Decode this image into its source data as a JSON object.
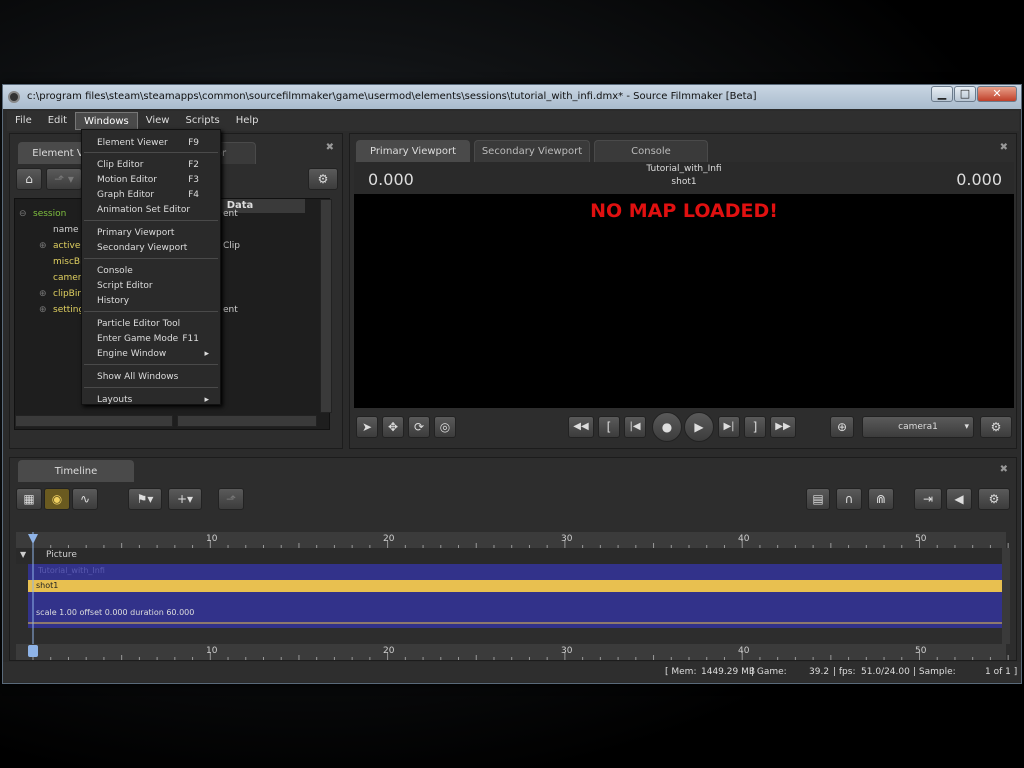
{
  "window": {
    "title": "c:\\program files\\steam\\steamapps\\common\\sourcefilmmaker\\game\\usermod\\elements\\sessions\\tutorial_with_infi.dmx* - Source Filmmaker [Beta]"
  },
  "window_buttons": {
    "minimize": "▁",
    "maximize": "□",
    "close": "✕"
  },
  "menu": [
    "File",
    "Edit",
    "Windows",
    "View",
    "Scripts",
    "Help"
  ],
  "left_panel": {
    "tab1": "Element V",
    "tab2": "or",
    "data_header": "Data",
    "tree": [
      {
        "label": "session",
        "expander": "⊖",
        "color": "#7fbf3f"
      },
      {
        "label": "name",
        "expander": "",
        "color": "#cfcfcf"
      },
      {
        "label": "activeC",
        "expander": "⊕",
        "color": "#e0d060"
      },
      {
        "label": "miscBir",
        "expander": "",
        "color": "#e0d060"
      },
      {
        "label": "camera",
        "expander": "",
        "color": "#e0d060"
      },
      {
        "label": "clipBin",
        "expander": "⊕",
        "color": "#e0d060"
      },
      {
        "label": "setting",
        "expander": "⊕",
        "color": "#e0d060"
      }
    ],
    "data_col": [
      "ent",
      "",
      "Clip",
      "",
      "",
      "",
      "ent"
    ]
  },
  "windows_menu": {
    "items": [
      {
        "label": "Element Viewer",
        "shortcut": "F9"
      },
      {
        "label": "Clip Editor",
        "shortcut": "F2"
      },
      {
        "label": "Motion Editor",
        "shortcut": "F3"
      },
      {
        "label": "Graph Editor",
        "shortcut": "F4"
      },
      {
        "label": "Animation Set Editor",
        "shortcut": ""
      },
      {
        "label": "Primary Viewport",
        "shortcut": ""
      },
      {
        "label": "Secondary Viewport",
        "shortcut": ""
      },
      {
        "label": "Console",
        "shortcut": ""
      },
      {
        "label": "Script Editor",
        "shortcut": ""
      },
      {
        "label": "History",
        "shortcut": ""
      },
      {
        "label": "Particle Editor Tool",
        "shortcut": ""
      },
      {
        "label": "Enter Game Mode",
        "shortcut": "F11"
      },
      {
        "label": "Engine Window",
        "shortcut": "▸"
      },
      {
        "label": "Show All Windows",
        "shortcut": ""
      },
      {
        "label": "Layouts",
        "shortcut": "▸"
      }
    ]
  },
  "viewport": {
    "tabs": [
      "Primary Viewport",
      "Secondary Viewport",
      "Console"
    ],
    "left_value": "0.000",
    "right_value": "0.000",
    "session_name": "Tutorial_with_Infi",
    "shot_name": "shot1",
    "message": "NO MAP LOADED!",
    "camera": "camera1"
  },
  "timeline": {
    "tab": "Timeline",
    "ruler_labels": [
      "10",
      "20",
      "30",
      "40",
      "50"
    ],
    "track_label": "Picture",
    "clip_title": "Tutorial_with_Infi",
    "shot_label": "shot1",
    "shot_info": "scale 1.00 offset 0.000 duration 60.000"
  },
  "status": {
    "mem": "[ Mem:",
    "mem_val": "1449.29 MB",
    "game": "| Game:",
    "game_val": "39.2",
    "fps": "| fps:",
    "fps_val": "51.0/24.00",
    "sample": "| Sample:",
    "sample_val": "1 of 1 ]"
  }
}
